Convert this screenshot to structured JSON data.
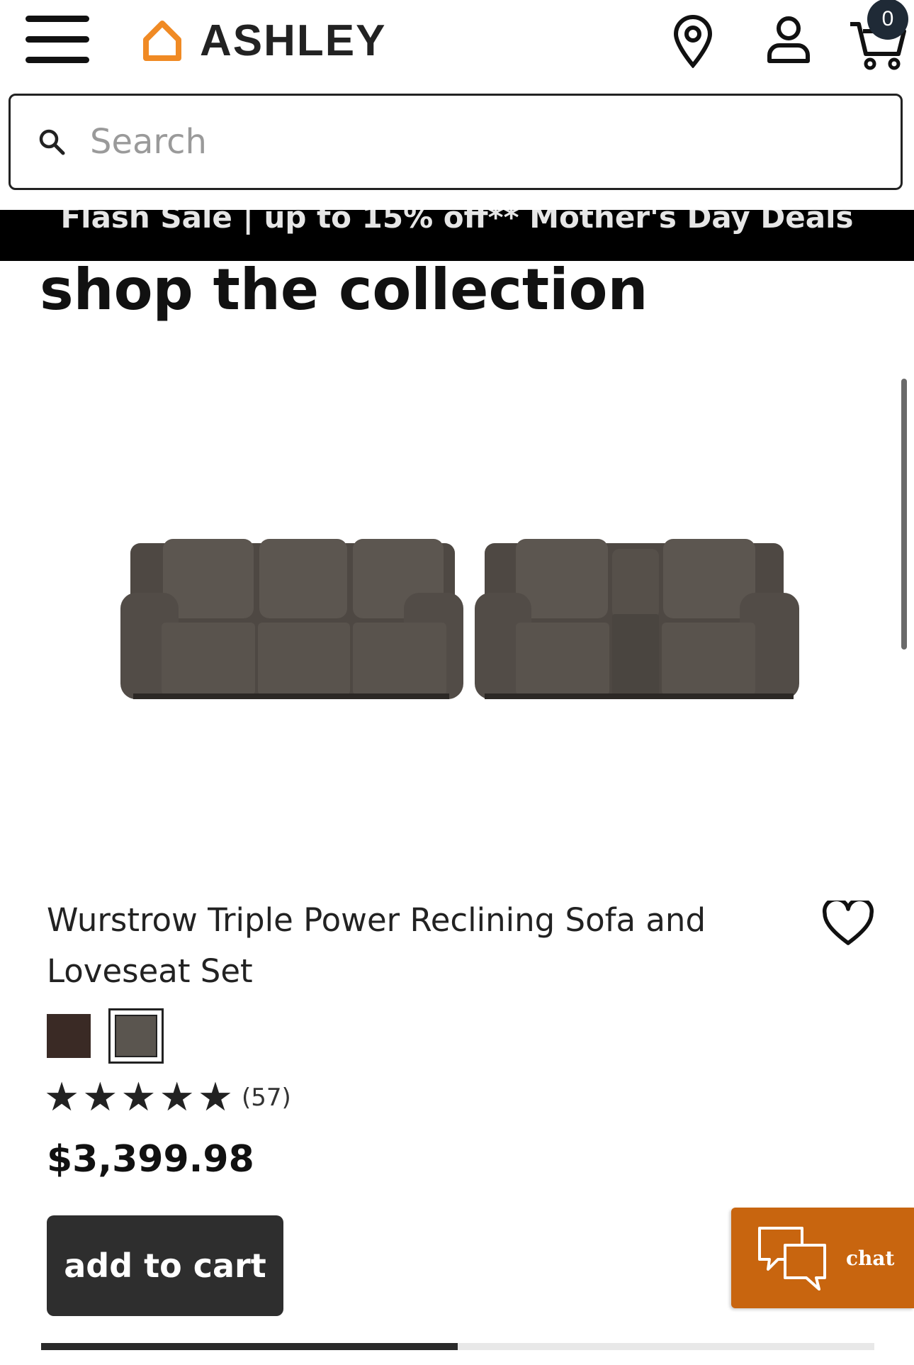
{
  "header": {
    "brand_name": "ASHLEY",
    "brand_color": "#f08a24",
    "icons": [
      "menu-icon",
      "store-location-icon",
      "account-icon",
      "cart-icon"
    ],
    "cart_count": "0"
  },
  "search": {
    "placeholder": "Search",
    "value": ""
  },
  "promo": {
    "text": "Flash Sale | up to 15% off** Mother's Day Deals"
  },
  "section": {
    "title": "shop the collection"
  },
  "product": {
    "title": "Wurstrow Triple Power Reclining Sofa and Loveseat Set",
    "swatches": [
      {
        "color": "#3a2a25",
        "selected": false
      },
      {
        "color": "#5a554f",
        "selected": true
      }
    ],
    "rating": 5,
    "review_count": "(57)",
    "price": "$3,399.98",
    "add_to_cart_label": "add to cart"
  },
  "chat": {
    "label": "chat",
    "color": "#c8650f"
  },
  "carousel": {
    "progress_fraction": 0.5
  }
}
